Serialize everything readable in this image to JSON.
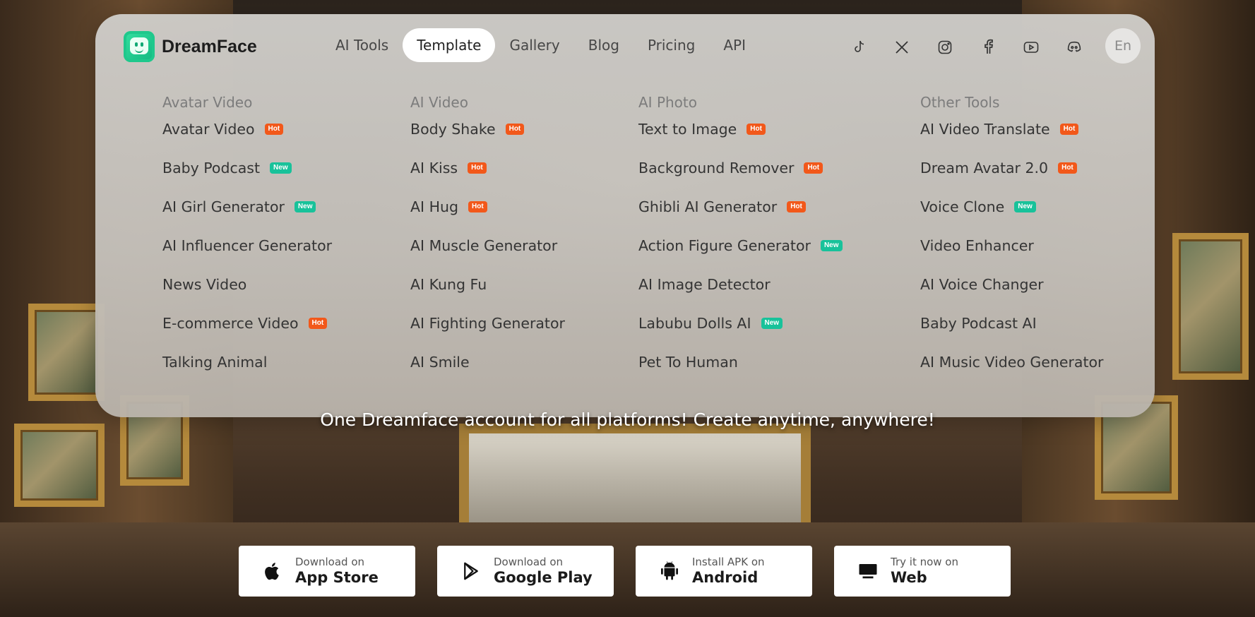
{
  "brand": {
    "name": "DreamFace"
  },
  "nav": [
    {
      "label": "AI Tools",
      "active": false
    },
    {
      "label": "Template",
      "active": true
    },
    {
      "label": "Gallery",
      "active": false
    },
    {
      "label": "Blog",
      "active": false
    },
    {
      "label": "Pricing",
      "active": false
    },
    {
      "label": "API",
      "active": false
    }
  ],
  "socials": [
    "tiktok-icon",
    "x-icon",
    "instagram-icon",
    "facebook-icon",
    "youtube-icon",
    "discord-icon"
  ],
  "language": "En",
  "menu": {
    "columns": [
      {
        "heading": "Avatar Video",
        "items": [
          {
            "label": "Avatar Video",
            "badge": "Hot"
          },
          {
            "label": "Baby Podcast",
            "badge": "New"
          },
          {
            "label": "AI Girl Generator",
            "badge": "New"
          },
          {
            "label": "AI Influencer Generator",
            "badge": ""
          },
          {
            "label": "News Video",
            "badge": ""
          },
          {
            "label": "E-commerce Video",
            "badge": "Hot"
          },
          {
            "label": "Talking Animal",
            "badge": ""
          }
        ]
      },
      {
        "heading": "AI Video",
        "items": [
          {
            "label": "Body Shake",
            "badge": "Hot"
          },
          {
            "label": "AI Kiss",
            "badge": "Hot"
          },
          {
            "label": "AI Hug",
            "badge": "Hot"
          },
          {
            "label": "AI Muscle Generator",
            "badge": ""
          },
          {
            "label": "AI Kung Fu",
            "badge": ""
          },
          {
            "label": "AI Fighting Generator",
            "badge": ""
          },
          {
            "label": "AI Smile",
            "badge": ""
          }
        ]
      },
      {
        "heading": "AI Photo",
        "items": [
          {
            "label": "Text to Image",
            "badge": "Hot"
          },
          {
            "label": "Background Remover",
            "badge": "Hot"
          },
          {
            "label": "Ghibli AI Generator",
            "badge": "Hot"
          },
          {
            "label": "Action Figure Generator",
            "badge": "New"
          },
          {
            "label": "AI Image Detector",
            "badge": ""
          },
          {
            "label": "Labubu Dolls AI",
            "badge": "New"
          },
          {
            "label": "Pet To Human",
            "badge": ""
          }
        ]
      },
      {
        "heading": "Other Tools",
        "items": [
          {
            "label": "AI Video Translate",
            "badge": "Hot"
          },
          {
            "label": "Dream Avatar 2.0",
            "badge": "Hot"
          },
          {
            "label": "Voice Clone",
            "badge": "New"
          },
          {
            "label": "Video Enhancer",
            "badge": ""
          },
          {
            "label": "AI Voice Changer",
            "badge": ""
          },
          {
            "label": "Baby Podcast AI",
            "badge": ""
          },
          {
            "label": "AI Music Video Generator",
            "badge": ""
          }
        ]
      }
    ]
  },
  "tagline": "One Dreamface account for all platforms! Create anytime, anywhere!",
  "downloads": [
    {
      "small": "Download on",
      "big": "App Store",
      "icon": "apple-icon"
    },
    {
      "small": "Download on",
      "big": "Google Play",
      "icon": "google-play-icon"
    },
    {
      "small": "Install APK on",
      "big": "Android",
      "icon": "android-icon"
    },
    {
      "small": "Try it now on",
      "big": "Web",
      "icon": "monitor-icon"
    }
  ]
}
